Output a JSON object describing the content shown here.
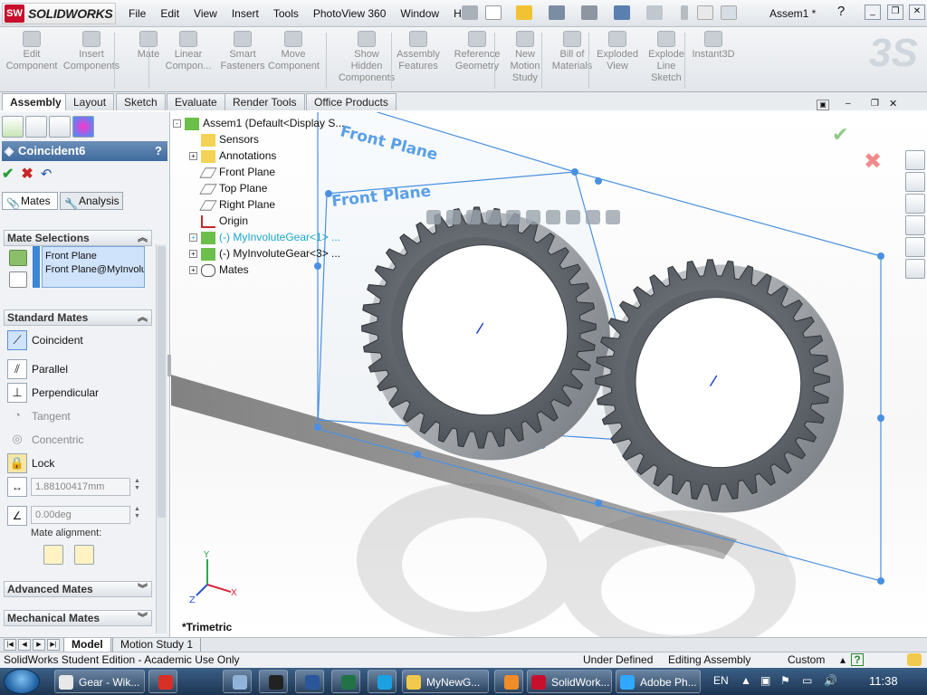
{
  "app": {
    "logo_mark": "SW",
    "logo_text": "SOLIDWORKS",
    "document_title": "Assem1 *",
    "help_label": "?"
  },
  "menu": [
    "File",
    "Edit",
    "View",
    "Insert",
    "Tools",
    "PhotoView 360",
    "Window",
    "Help"
  ],
  "command_manager": [
    {
      "label": "Edit\nComponent",
      "icon": "edit-component-icon",
      "enabled": false
    },
    {
      "label": "Insert\nComponents",
      "icon": "insert-components-icon",
      "enabled": false
    },
    {
      "label": "Mate",
      "icon": "mate-icon",
      "enabled": false
    },
    {
      "label": "Linear\nCompon...",
      "icon": "linear-pattern-icon",
      "enabled": false
    },
    {
      "label": "Smart\nFasteners",
      "icon": "smart-fasteners-icon",
      "enabled": false
    },
    {
      "label": "Move\nComponent",
      "icon": "move-component-icon",
      "enabled": false
    },
    {
      "label": "Show\nHidden\nComponents",
      "icon": "show-hidden-icon",
      "enabled": false
    },
    {
      "label": "Assembly\nFeatures",
      "icon": "assembly-features-icon",
      "enabled": false
    },
    {
      "label": "Reference\nGeometry",
      "icon": "reference-geometry-icon",
      "enabled": false
    },
    {
      "label": "New\nMotion\nStudy",
      "icon": "motion-study-icon",
      "enabled": false
    },
    {
      "label": "Bill of\nMaterials",
      "icon": "bom-icon",
      "enabled": false
    },
    {
      "label": "Exploded\nView",
      "icon": "exploded-view-icon",
      "enabled": false
    },
    {
      "label": "Explode\nLine\nSketch",
      "icon": "explode-line-icon",
      "enabled": false
    },
    {
      "label": "Instant3D",
      "icon": "instant3d-icon",
      "enabled": false
    }
  ],
  "tabs": [
    "Assembly",
    "Layout",
    "Sketch",
    "Evaluate",
    "Render Tools",
    "Office Products"
  ],
  "active_tab": "Assembly",
  "property_manager": {
    "title": "Coincident6",
    "help": "?",
    "subtabs": [
      "Mates",
      "Analysis"
    ],
    "mate_selections": {
      "header": "Mate Selections",
      "items": [
        "Front Plane",
        "Front Plane@MyInvolu"
      ]
    },
    "standard_mates": {
      "header": "Standard Mates",
      "items": [
        {
          "label": "Coincident",
          "icon": "coincident-icon",
          "enabled": true
        },
        {
          "label": "Parallel",
          "icon": "parallel-icon",
          "enabled": true
        },
        {
          "label": "Perpendicular",
          "icon": "perpendicular-icon",
          "enabled": true
        },
        {
          "label": "Tangent",
          "icon": "tangent-icon",
          "enabled": false
        },
        {
          "label": "Concentric",
          "icon": "concentric-icon",
          "enabled": false
        },
        {
          "label": "Lock",
          "icon": "lock-icon",
          "enabled": true
        }
      ],
      "distance_value": "1.88100417mm",
      "angle_value": "0.00deg",
      "mate_alignment_label": "Mate alignment:"
    },
    "advanced_mates_header": "Advanced Mates",
    "mechanical_mates_header": "Mechanical Mates"
  },
  "feature_tree": [
    {
      "label": "Assem1  (Default<Display S...",
      "icon": "assembly-icon",
      "expander": "-",
      "color": "normal"
    },
    {
      "label": "Sensors",
      "icon": "sensors-icon",
      "expander": "",
      "color": "normal"
    },
    {
      "label": "Annotations",
      "icon": "annotations-icon",
      "expander": "+",
      "color": "normal"
    },
    {
      "label": "Front Plane",
      "icon": "plane-icon",
      "expander": "",
      "color": "normal"
    },
    {
      "label": "Top Plane",
      "icon": "plane-icon",
      "expander": "",
      "color": "normal"
    },
    {
      "label": "Right Plane",
      "icon": "plane-icon",
      "expander": "",
      "color": "normal"
    },
    {
      "label": "Origin",
      "icon": "origin-icon",
      "expander": "",
      "color": "normal"
    },
    {
      "label": "(-) MyInvoluteGear<1> ...",
      "icon": "part-icon",
      "expander": "+",
      "color": "blue"
    },
    {
      "label": "(-) MyInvoluteGear<3> ...",
      "icon": "part-icon",
      "expander": "+",
      "color": "normal"
    },
    {
      "label": "Mates",
      "icon": "mates-icon",
      "expander": "+",
      "color": "normal"
    }
  ],
  "viewport": {
    "plane_labels": [
      "Front Plane",
      "Front Plane"
    ],
    "view_orientation": "*Trimetric",
    "triad": {
      "x": "X",
      "y": "Y",
      "z": "Z"
    }
  },
  "bottom_tabs": [
    "Model",
    "Motion Study 1"
  ],
  "active_bottom_tab": "Model",
  "status": {
    "edition": "SolidWorks Student Edition - Academic Use Only",
    "definition": "Under Defined",
    "mode": "Editing Assembly",
    "units": "Custom",
    "units_help": "?"
  },
  "taskbar": {
    "items": [
      {
        "label": "Gear - Wik...",
        "icon": "chrome-icon"
      },
      {
        "label": "",
        "icon": "gmail-icon"
      },
      {
        "label": "",
        "icon": "settings-icon"
      },
      {
        "label": "",
        "icon": "user-icon"
      },
      {
        "label": "",
        "icon": "word-icon"
      },
      {
        "label": "",
        "icon": "excel-icon"
      },
      {
        "label": "",
        "icon": "ie-icon"
      },
      {
        "label": "MyNewG...",
        "icon": "folder-icon"
      },
      {
        "label": "",
        "icon": "media-player-icon"
      },
      {
        "label": "SolidWork...",
        "icon": "solidworks-icon"
      },
      {
        "label": "Adobe Ph...",
        "icon": "photoshop-icon"
      }
    ],
    "language": "EN",
    "clock": "11:38"
  }
}
